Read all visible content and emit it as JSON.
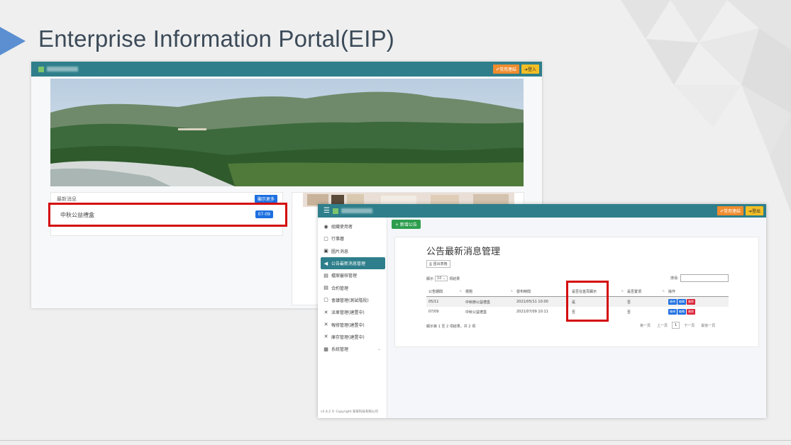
{
  "slide": {
    "title": "Enterprise Information Portal(EIP)"
  },
  "colors": {
    "navbar": "#2e7f8b",
    "accent_blue": "#1e6fe0",
    "highlight_red": "#d40b0b",
    "btn_orange": "#f08c2e",
    "btn_yellow": "#f4be24"
  },
  "portal_home": {
    "nav": {
      "links_button": "✐常用連結",
      "login_button": "➜登入"
    },
    "news": {
      "header": "最新消息",
      "more_button": "顯示更多",
      "items": [
        {
          "title": "中秋公益禮盒",
          "date": "07-09"
        }
      ]
    }
  },
  "admin": {
    "nav": {
      "links_button": "✐常用連結",
      "logout_button": "➜登出"
    },
    "sidebar": {
      "items": [
        {
          "icon": "user-icon",
          "glyph": "◉",
          "label": "組織使用者"
        },
        {
          "icon": "calendar-icon",
          "glyph": "▢",
          "label": "行事曆"
        },
        {
          "icon": "image-icon",
          "glyph": "▣",
          "label": "圖片消息"
        },
        {
          "icon": "megaphone-icon",
          "glyph": "◀",
          "label": "公告最新消息管理"
        },
        {
          "icon": "document-icon",
          "glyph": "▤",
          "label": "檔案審核管理"
        },
        {
          "icon": "contract-icon",
          "glyph": "▤",
          "label": "合約管理"
        },
        {
          "icon": "meeting-icon",
          "glyph": "▢",
          "label": "會議管理(測試階段)"
        },
        {
          "icon": "tools-icon",
          "glyph": "✕",
          "label": "派車管理(建置中)"
        },
        {
          "icon": "tools-icon",
          "glyph": "✕",
          "label": "報修管理(建置中)"
        },
        {
          "icon": "tools-icon",
          "glyph": "✕",
          "label": "庫存管理(建置中)"
        },
        {
          "icon": "settings-icon",
          "glyph": "▦",
          "label": "系統管理"
        }
      ],
      "footer": "v1.4.2 © Copyright 某某科技有限公司"
    },
    "add_button": "+ 新增公告",
    "panel": {
      "title": "公告最新消息管理",
      "export_button": "⎙ 匯出表格",
      "length_prefix": "顯示",
      "length_value": "10",
      "length_suffix": "項結果",
      "search_label": "搜尋:",
      "columns": [
        "公告期間",
        "標題",
        "發布時間",
        "是否在首頁顯示",
        "是否置頂",
        "操作"
      ],
      "rows": [
        {
          "period": "05/11",
          "title": "中秋節公益禮盒",
          "published": "2021/05/11 10:00",
          "show_home": "是",
          "pinned": "否"
        },
        {
          "period": "07/09",
          "title": "中秋公益禮盒",
          "published": "2021/07/09 10:11",
          "show_home": "否",
          "pinned": "否"
        }
      ],
      "actions": {
        "view": "檢視",
        "edit": "編輯",
        "delete": "刪除"
      },
      "info": "顯示第 1 至 2 項結果，共 2 項",
      "pager": {
        "first": "第一頁",
        "prev": "上一頁",
        "current": "1",
        "next": "下一頁",
        "last": "最後一頁"
      }
    }
  }
}
